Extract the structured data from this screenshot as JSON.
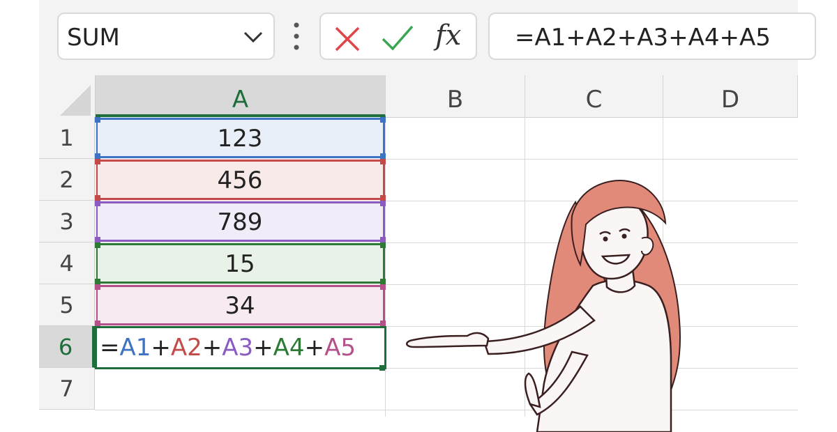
{
  "toolbar": {
    "name_box": "SUM",
    "formula_bar": "=A1+A2+A3+A4+A5",
    "fx_label": "fx",
    "colors": {
      "cancel": "#e0454b",
      "enter": "#3aa652"
    }
  },
  "grid": {
    "columns": [
      "A",
      "B",
      "C",
      "D"
    ],
    "rows": [
      "1",
      "2",
      "3",
      "4",
      "5",
      "6",
      "7"
    ],
    "cells": [
      {
        "ref": "A1",
        "value": "123",
        "highlight": "#e8eff8",
        "border": "#3d73c4"
      },
      {
        "ref": "A2",
        "value": "456",
        "highlight": "#f9eaea",
        "border": "#c44a4a"
      },
      {
        "ref": "A3",
        "value": "789",
        "highlight": "#f1edf8",
        "border": "#8a5cc2"
      },
      {
        "ref": "A4",
        "value": "15",
        "highlight": "#e8f2e8",
        "border": "#2c7a35"
      },
      {
        "ref": "A5",
        "value": "34",
        "highlight": "#f7eaf1",
        "border": "#b4508a"
      }
    ],
    "active_cell": {
      "ref": "A6",
      "parts": [
        {
          "text": "=",
          "color": "#222222"
        },
        {
          "text": "A1",
          "color": "#3d73c4"
        },
        {
          "text": "+",
          "color": "#222222"
        },
        {
          "text": "A2",
          "color": "#c44a4a"
        },
        {
          "text": "+",
          "color": "#222222"
        },
        {
          "text": "A3",
          "color": "#8a5cc2"
        },
        {
          "text": "+",
          "color": "#222222"
        },
        {
          "text": "A4",
          "color": "#2c7a35"
        },
        {
          "text": "+",
          "color": "#222222"
        },
        {
          "text": "A5",
          "color": "#b4508a"
        }
      ]
    },
    "selected_column": "A",
    "selected_row": "6",
    "accent": "#1e6e3c"
  },
  "illustration": {
    "icon": "woman-presenting-illustration"
  }
}
